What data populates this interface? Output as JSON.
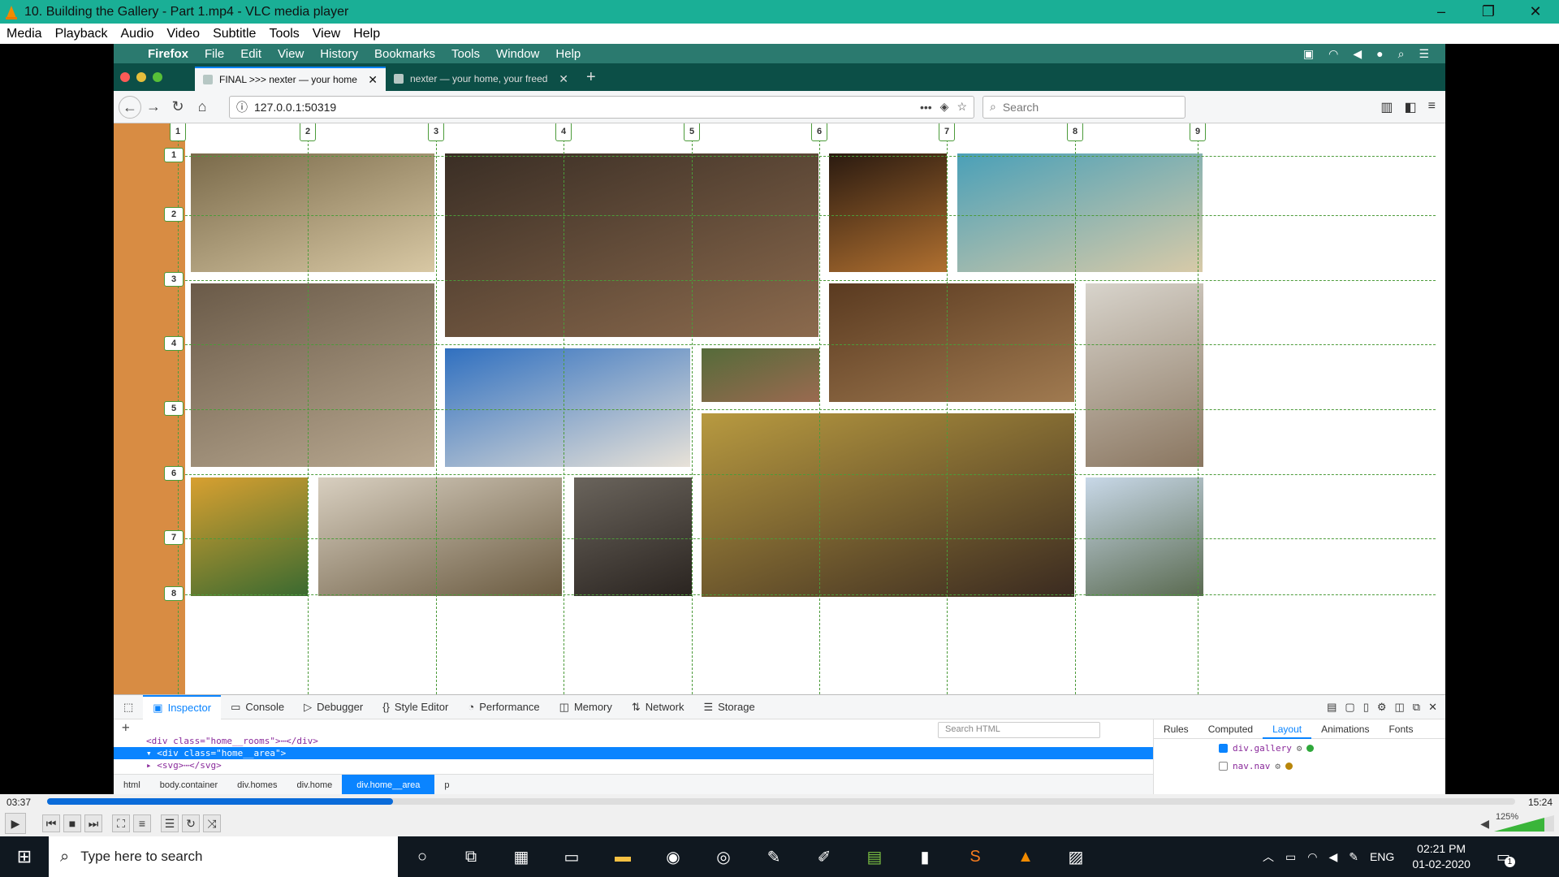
{
  "window": {
    "title": "10. Building the Gallery - Part 1.mp4 - VLC media player"
  },
  "vlc_menu": [
    "Media",
    "Playback",
    "Audio",
    "Video",
    "Subtitle",
    "Tools",
    "View",
    "Help"
  ],
  "mac_menu": {
    "app": "Firefox",
    "items": [
      "File",
      "Edit",
      "View",
      "History",
      "Bookmarks",
      "Tools",
      "Window",
      "Help"
    ]
  },
  "tabs": [
    {
      "label": "FINAL >>> nexter — your home",
      "active": true
    },
    {
      "label": "nexter — your home, your freed",
      "active": false
    }
  ],
  "address": {
    "url": "127.0.0.1:50319",
    "search_placeholder": "Search"
  },
  "grid": {
    "col_numbers": [
      "1",
      "2",
      "3",
      "4",
      "5",
      "6",
      "7",
      "8",
      "9"
    ],
    "row_numbers": [
      "1",
      "2",
      "3",
      "4",
      "5",
      "6",
      "7",
      "8"
    ]
  },
  "devtools": {
    "tabs": [
      "Inspector",
      "Console",
      "Debugger",
      "Style Editor",
      "Performance",
      "Memory",
      "Network",
      "Storage"
    ],
    "active_tab": "Inspector",
    "search_placeholder": "Search HTML",
    "html_rows": [
      {
        "text": "<div class=\"home__rooms\">⋯</div>",
        "selected": false
      },
      {
        "text": "▾ <div class=\"home__area\">",
        "selected": true
      },
      {
        "text": "   ▸ <svg>⋯</svg>",
        "selected": false
      }
    ],
    "breadcrumbs": [
      "html",
      "body.container",
      "div.homes",
      "div.home",
      "div.home__area",
      "p"
    ],
    "breadcrumb_selected": "div.home__area",
    "right_tabs": [
      "Rules",
      "Computed",
      "Layout",
      "Animations",
      "Fonts"
    ],
    "right_active": "Layout",
    "layout_items": [
      {
        "label": "div.gallery",
        "checked": true,
        "color": "#2fa83b"
      },
      {
        "label": "nav.nav",
        "checked": false,
        "color": "#b8860b"
      }
    ]
  },
  "player": {
    "elapsed": "03:37",
    "total": "15:24",
    "progress": 0.2352,
    "volume": "125%"
  },
  "taskbar": {
    "search_placeholder": "Type here to search",
    "lang": "ENG",
    "time": "02:21 PM",
    "date": "01-02-2020",
    "notification_count": "1"
  },
  "colors": {
    "vlc_title": "#1aaf96",
    "sidebar": "#d88c43",
    "grid": "#4c9b3a",
    "accent": "#0a84ff"
  }
}
